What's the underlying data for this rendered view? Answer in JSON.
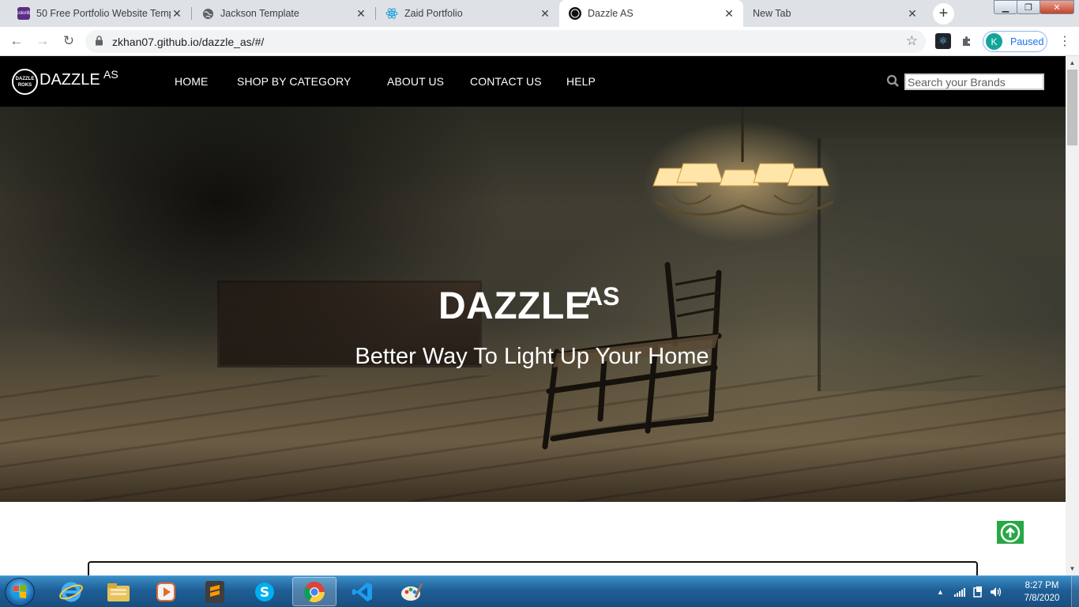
{
  "browser": {
    "tabs": [
      {
        "title": "50 Free Portfolio Website Templ",
        "favicon": "colorlib-icon",
        "active": false
      },
      {
        "title": "Jackson Template",
        "favicon": "globe-icon",
        "active": false
      },
      {
        "title": "Zaid Portfolio",
        "favicon": "react-icon",
        "active": false
      },
      {
        "title": "Dazzle AS",
        "favicon": "dazzle-icon",
        "active": true
      },
      {
        "title": "New Tab",
        "favicon": "",
        "active": false
      }
    ],
    "favicon_labels": {
      "colorlib": "colorlib"
    },
    "url": "zkhan07.github.io/dazzle_as/#/",
    "profile": {
      "initial": "K",
      "status": "Paused"
    }
  },
  "site": {
    "logo": {
      "badge_top": "DAZZLE",
      "badge_bottom": "ROKS",
      "text": "DAZZLE",
      "sup": "AS"
    },
    "nav": [
      "HOME",
      "SHOP BY CATEGORY",
      "ABOUT US",
      "CONTACT US",
      "HELP"
    ],
    "search_placeholder": "Search your Brands",
    "hero": {
      "title": "DAZZLE",
      "title_sup": "AS",
      "subtitle": "Better Way To Light Up Your Home"
    }
  },
  "taskbar": {
    "apps": [
      "internet-explorer-icon",
      "file-explorer-icon",
      "media-player-icon",
      "sublime-text-icon",
      "skype-icon",
      "chrome-icon",
      "vscode-icon",
      "paint-icon"
    ],
    "active_app": "chrome-icon",
    "time": "8:27 PM",
    "date": "7/8/2020"
  },
  "colors": {
    "nav_bg": "#000000",
    "to_top": "#28a745",
    "profile_avatar": "#12a59a",
    "link_blue": "#1a73e8"
  }
}
